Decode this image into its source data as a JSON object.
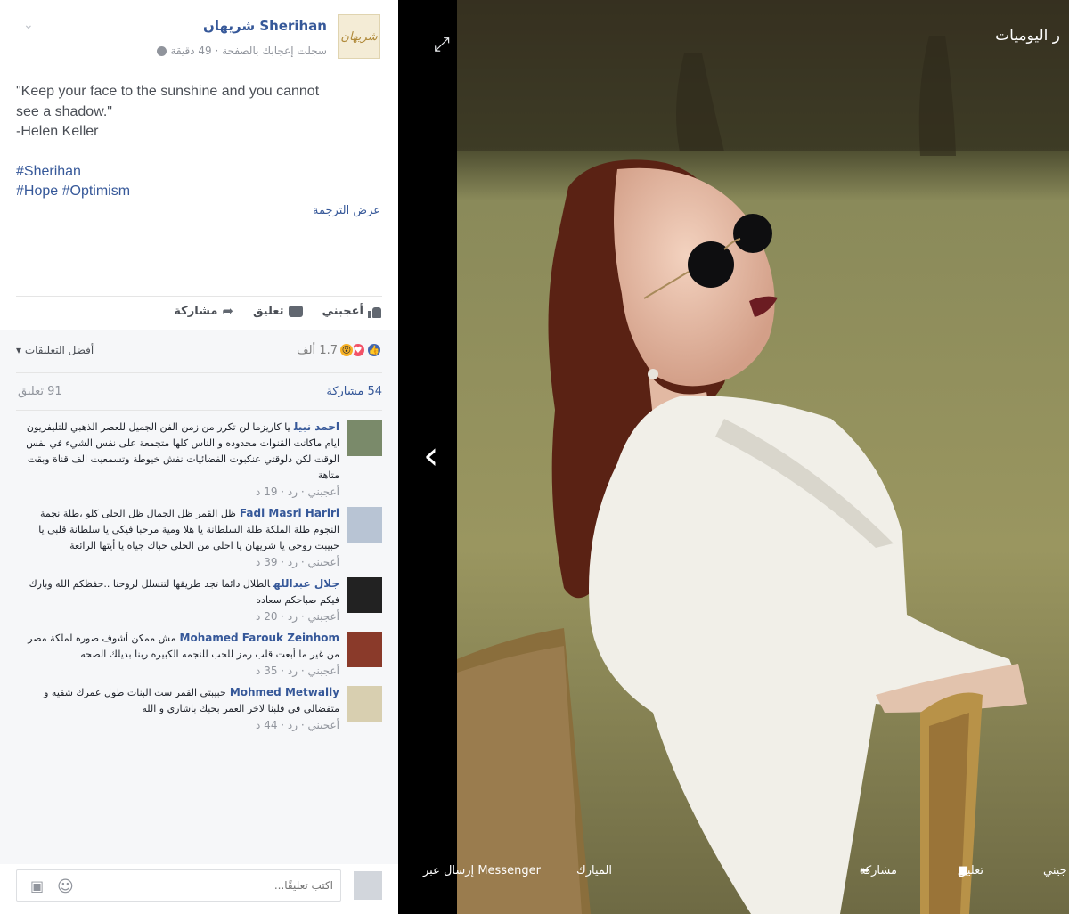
{
  "post": {
    "page_name": "Sherihan شريهان",
    "logo_text": "شريهان",
    "subtitle": "سجلت إعجابك بالصفحة · 49 دقيقة",
    "text_lines": [
      "\"Keep your face to the sunshine and you cannot",
      "see a shadow.\"",
      "-Helen Keller"
    ],
    "hashtag_lines": [
      "#Sherihan",
      "#Hope #Optimism"
    ],
    "translate_link": "عرض الترجمة",
    "actions": {
      "like": "أعجبني",
      "comment": "تعليق",
      "share": "مشاركة"
    }
  },
  "reactions": {
    "count": "1.7 ألف",
    "icons": [
      "like-icon",
      "love-icon",
      "wow-icon"
    ],
    "sort_label": "أفضل التعليقات ▾"
  },
  "counts": {
    "shares": "54 مشاركة",
    "comments": "91 تعليق"
  },
  "comments": [
    {
      "author": "احمد نبيل",
      "text": "يا كاريزما لن تكرر من زمن الفن الجميل للعصر الذهبي للتليفزيون ايام ماكانت القنوات محدوده و الناس كلها متجمعة على نفس الشيء في نفس الوقت لكن دلوقتي عنكبوت الفضائيات نفش خيوطة وتسمعيت الف قناة وبقت متاهة",
      "meta": "أعجبني · رد · 19 د"
    },
    {
      "author": "Fadi Masri Hariri",
      "text": "ظل القمر ظل الجمال ظل الحلى كلو ،طلة نجمة النجوم طلة الملكة طلة السلطانة يا هلا ومية مرحبا فيكي يا سلطانة قلبي يا حبيبت روحي يا شريهان يا احلى من الحلى حباك جياه يا أيتها الرائعة",
      "meta": "أعجبني · رد · 39 د"
    },
    {
      "author": "جلال عبدالله",
      "text": "الطلال دائما تجد طريقها لتتسلل لروحنا ..حفظكم الله وبارك فيكم صباحكم سعاده",
      "meta": "أعجبني · رد · 20 د"
    },
    {
      "author": "Mohamed Farouk Zeinhom",
      "text": "مش ممكن أشوف صوره لملكة مصر من غير ما أبعت قلب رمز للحب للنجمه الكبيره ربنا بديلك الصحه",
      "meta": "أعجبني · رد · 35 د"
    },
    {
      "author": "Mohmed Metwally",
      "text": "حبيبتي القمر ست البنات طول عمرك شقيه و متفضالي في قلبنا لاخر العمر بحبك باشاري و الله",
      "meta": "أعجبني · رد · 44 د"
    }
  ],
  "composer": {
    "placeholder": "اكتب تعليقًا..."
  },
  "viewer": {
    "album_title": "ر اليوميات",
    "bar": {
      "like": "جيني",
      "comment": "تعليق",
      "share": "مشاركة",
      "tag": "الميارك",
      "messenger": "إرسال عبر Messenger"
    }
  },
  "colors": {
    "link": "#365899",
    "like": "#4267b2",
    "love": "#f25268",
    "wow": "#f7b125"
  }
}
